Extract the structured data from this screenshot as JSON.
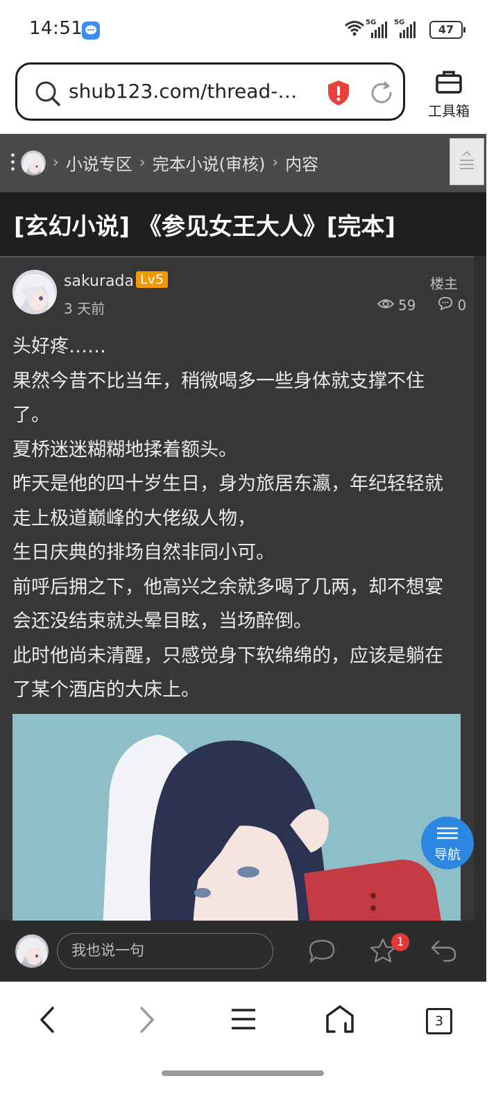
{
  "status_bar": {
    "time": "14:51",
    "network_1": "5G",
    "network_2": "5G",
    "battery": "47"
  },
  "browser": {
    "url": "shub123.com/thread-26...",
    "toolbox_label": "工具箱"
  },
  "breadcrumb": {
    "items": [
      "小说专区",
      "完本小说(审核)",
      "内容"
    ]
  },
  "thread": {
    "title": "[玄幻小说] 《参见女王大人》[完本]",
    "author": "sakurada",
    "level": "Lv5",
    "time": "3 天前",
    "floor": "楼主",
    "views": "59",
    "comments": "0",
    "body": [
      "头好疼……",
      "果然今昔不比当年，稍微喝多一些身体就支撑不住了。",
      "夏桥迷迷糊糊地揉着额头。",
      "昨天是他的四十岁生日，身为旅居东瀛，年纪轻轻就走上极道巅峰的大佬级人物，",
      "生日庆典的排场自然非同小可。",
      "前呼后拥之下，他高兴之余就多喝了几两，却不想宴会还没结束就头晕目眩，当场醉倒。",
      "此时他尚未清醒，只感觉身下软绵绵的，应该是躺在了某个酒店的大床上。"
    ]
  },
  "fab": {
    "label": "导航"
  },
  "comment_bar": {
    "placeholder": "我也说一句",
    "favorite_badge": "1"
  },
  "bottom_nav": {
    "tabs_count": "3"
  },
  "colors": {
    "accent": "#2b87e0",
    "level": "#f39800",
    "badge": "#e53935",
    "page_bg": "#373737"
  }
}
